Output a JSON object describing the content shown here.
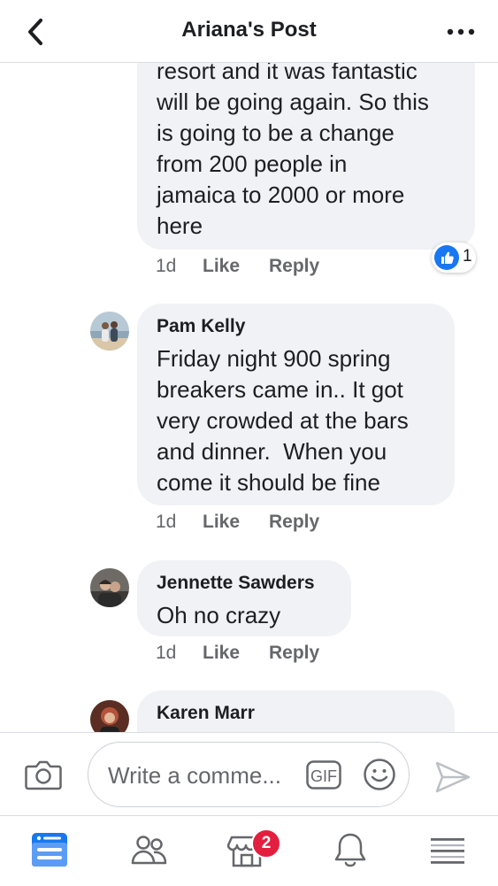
{
  "header": {
    "title": "Ariana's Post",
    "back_icon": "chevron-left-icon",
    "more_icon": "more-horizontal-icon"
  },
  "comments": [
    {
      "text": "resort and it was fantastic\nwill be going again. So this\nis going to be a change\nfrom 200 people in\njamaica to 2000 or more\nhere",
      "time": "1d",
      "like_label": "Like",
      "reply_label": "Reply",
      "reaction_count": "1"
    },
    {
      "author": "Pam Kelly",
      "text": "Friday night 900 spring\nbreakers came in.. It got\nvery crowded at the bars\nand dinner.  When you\ncome it should be fine",
      "time": "1d",
      "like_label": "Like",
      "reply_label": "Reply"
    },
    {
      "author": "Jennette Sawders",
      "text": "Oh no crazy",
      "time": "1d",
      "like_label": "Like",
      "reply_label": "Reply"
    },
    {
      "author": "Karen Marr"
    }
  ],
  "composer": {
    "placeholder": "Write a comme...",
    "gif_label": "GIF",
    "camera_icon": "camera-icon",
    "emoji_icon": "emoji-icon",
    "send_icon": "send-icon"
  },
  "tabbar": {
    "items": [
      "home-feed-icon",
      "friends-icon",
      "marketplace-icon",
      "notifications-icon",
      "menu-icon"
    ],
    "marketplace_badge": "2"
  },
  "colors": {
    "accent": "#1877f2",
    "bubble": "#f0f2f5",
    "badge": "#e41e3f",
    "meta_text": "#65676b"
  }
}
